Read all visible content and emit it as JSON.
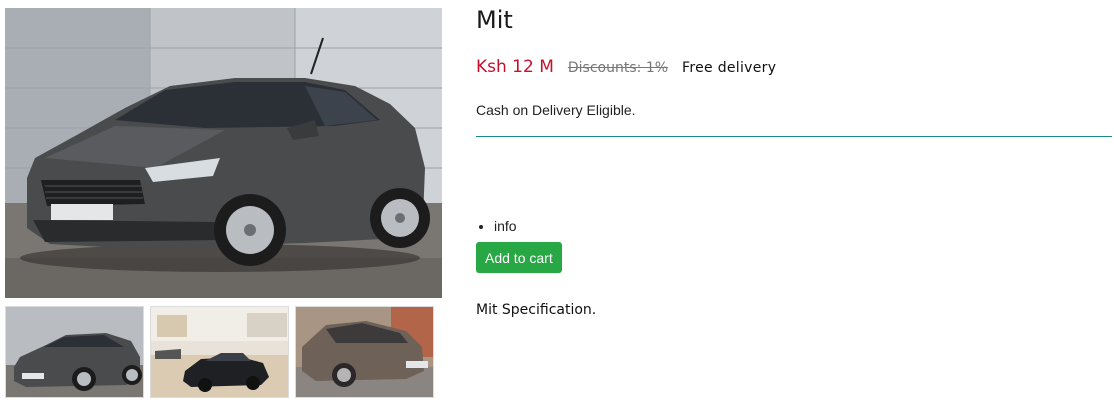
{
  "product": {
    "title": "Mit",
    "price": "Ksh 12 M",
    "discount": "Discounts: 1%",
    "delivery": "Free delivery",
    "cod_note": "Cash on Delivery Eligible.",
    "info_items": [
      "info"
    ],
    "add_to_cart_label": "Add to cart",
    "specification_title": "Mit Specification."
  },
  "gallery": {
    "main_image": "grey-hatchback-photo",
    "thumbnails": [
      "grey-hatchback-photo",
      "black-muscle-car-photo",
      "bronze-sedan-photo"
    ]
  },
  "colors": {
    "price": "#c8102e",
    "cart_button": "#28a745",
    "divider": "#1f8a8a"
  }
}
